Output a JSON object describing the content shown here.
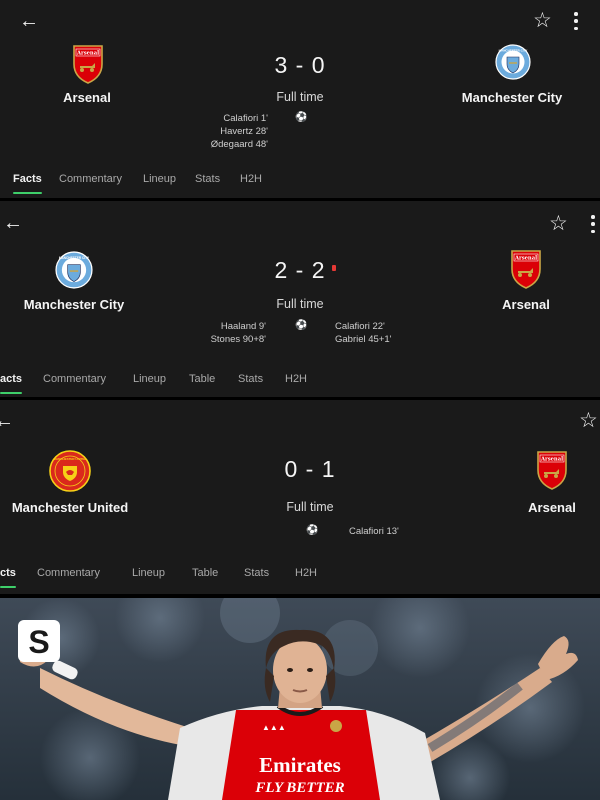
{
  "matches": [
    {
      "home": {
        "name": "Arsenal",
        "crest": "arsenal-crest",
        "crest_text": "Arsenal"
      },
      "away": {
        "name": "Manchester City",
        "crest": "man-city-crest",
        "crest_text": "MANCHESTER CITY"
      },
      "score": "3 - 0",
      "status": "Full time",
      "home_scorers": [
        "Calafiori 1'",
        "Havertz 28'",
        "Ødegaard 48'"
      ],
      "away_scorers": [],
      "tabs": [
        "Facts",
        "Commentary",
        "Lineup",
        "Stats",
        "H2H"
      ],
      "active_tab": "Facts"
    },
    {
      "home": {
        "name": "Manchester City",
        "crest": "man-city-crest",
        "crest_text": "MANCHESTER CITY"
      },
      "away": {
        "name": "Arsenal",
        "crest": "arsenal-crest",
        "crest_text": "Arsenal"
      },
      "score": "2 - 2",
      "status": "Full time",
      "home_scorers": [
        "Haaland 9'",
        "Stones 90+8'"
      ],
      "away_scorers": [
        "Calafiori 22'",
        "Gabriel 45+1'"
      ],
      "tabs": [
        "acts",
        "Commentary",
        "Lineup",
        "Table",
        "Stats",
        "H2H"
      ],
      "active_tab": "acts"
    },
    {
      "home": {
        "name": "Manchester United",
        "crest": "man-united-crest",
        "crest_text": "MANCHESTER UNITED"
      },
      "away": {
        "name": "Arsenal",
        "crest": "arsenal-crest",
        "crest_text": "Arsenal"
      },
      "score": "0 - 1",
      "status": "Full time",
      "home_scorers": [],
      "away_scorers": [
        "Calafiori 13'"
      ],
      "tabs": [
        "cts",
        "Commentary",
        "Lineup",
        "Table",
        "Stats",
        "H2H"
      ],
      "active_tab": "cts"
    }
  ],
  "icons": {
    "back": "back-arrow-icon",
    "favorite": "star-outline-icon",
    "more": "kebab-menu-icon",
    "goal": "football-icon"
  },
  "photo": {
    "logo_text": "S",
    "shirt_sponsor": "Emirates",
    "shirt_slogan": "FLY BETTER"
  },
  "colors": {
    "background": "#1a1a1a",
    "active_tab_indicator": "#3ecf6a",
    "live_indicator": "#e53935",
    "arsenal_red": "#db0007",
    "city_blue": "#6cabdd",
    "united_red": "#da291c"
  }
}
